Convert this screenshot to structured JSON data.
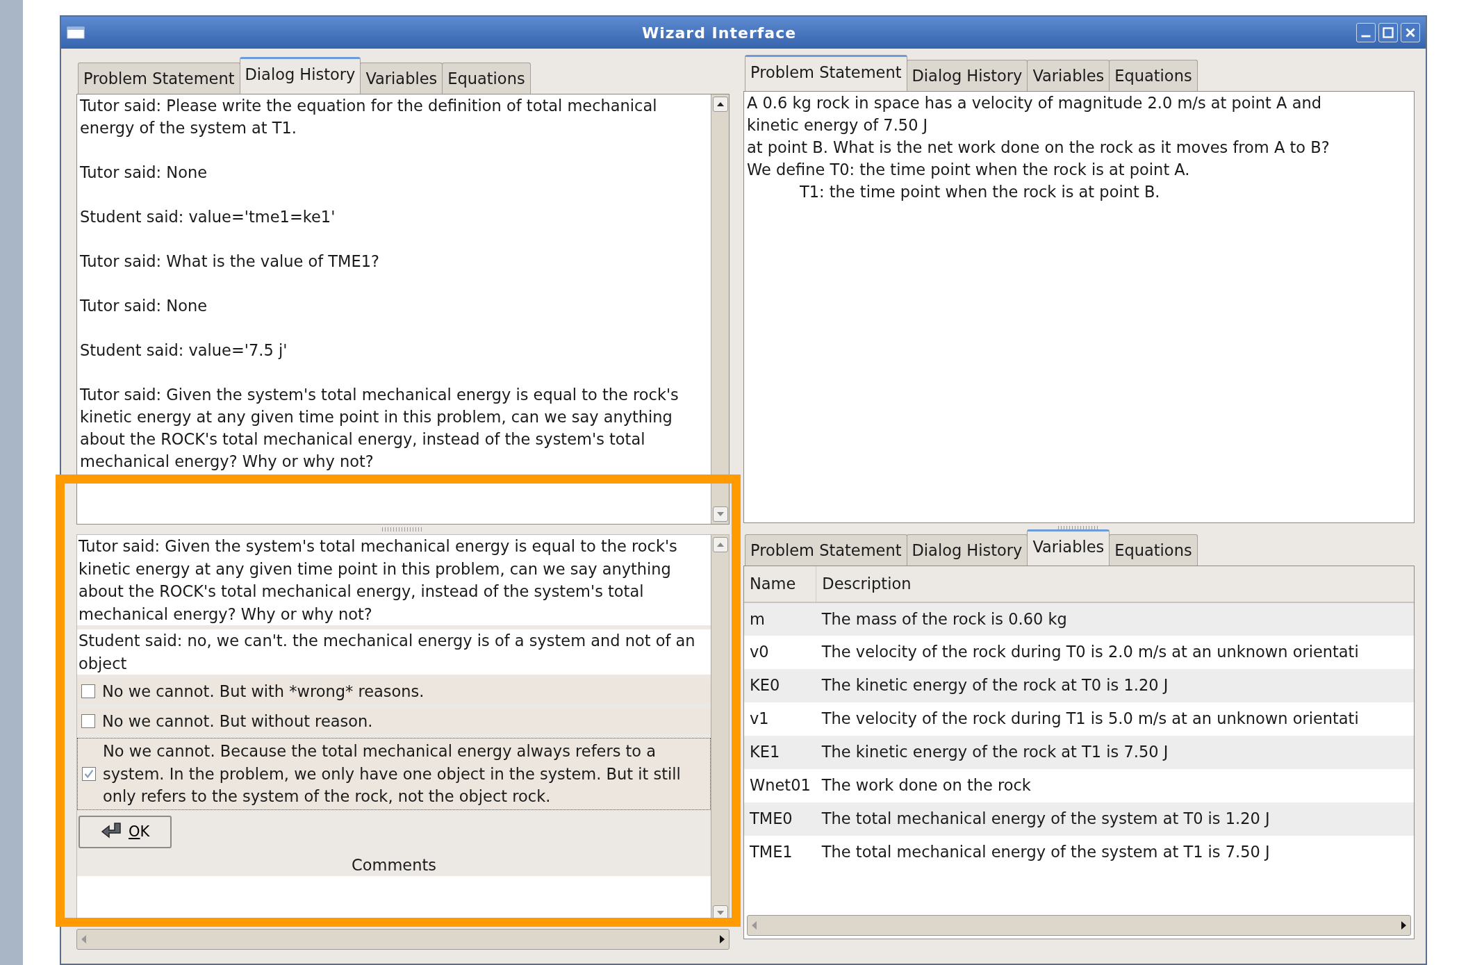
{
  "window": {
    "title": "Wizard Interface"
  },
  "left_panel": {
    "tabs": [
      {
        "label": "Problem Statement",
        "selected": false
      },
      {
        "label": "Dialog History",
        "selected": true
      },
      {
        "label": "Variables",
        "selected": false
      },
      {
        "label": "Equations",
        "selected": false
      }
    ],
    "dialog_history": [
      "Tutor said: Please write the equation for the definition of total mechanical energy of the system at T1.",
      "Tutor said: None",
      "Student said: value='tme1=ke1'",
      "Tutor said: What is the value of TME1?",
      "Tutor said: None",
      "Student said: value='7.5 j'",
      "Tutor said: Given the system's total mechanical energy is equal to the rock's kinetic energy at any given time point in this problem, can we say anything about the ROCK's total mechanical energy, instead of the system's total mechanical energy? Why or why not?"
    ],
    "tutor_message": "Tutor said: Given the system's total mechanical energy is equal to the rock's kinetic energy at any given time point in this problem, can we say anything about the ROCK's total mechanical energy, instead of the system's total mechanical energy? Why or why not?",
    "student_message": "Student said: no, we can't.  the mechanical energy is of a system and not of an object",
    "options": [
      {
        "label": "No we cannot. But with *wrong* reasons.",
        "checked": false,
        "focused": false
      },
      {
        "label": "No we cannot. But without reason.",
        "checked": false,
        "focused": false
      },
      {
        "label": "No we cannot. Because the total mechanical energy always refers to a system. In the problem, we only have one object in the system. But it still only refers to the system of the rock, not the object rock.",
        "checked": true,
        "focused": true
      }
    ],
    "ok_button": "OK",
    "comments_label": "Comments"
  },
  "right_top": {
    "tabs": [
      {
        "label": "Problem Statement",
        "selected": true
      },
      {
        "label": "Dialog History",
        "selected": false
      },
      {
        "label": "Variables",
        "selected": false
      },
      {
        "label": "Equations",
        "selected": false
      }
    ],
    "problem_statement": [
      {
        "text": "A 0.6 kg rock in space has a velocity of magnitude 2.0 m/s at point A and",
        "indented": false
      },
      {
        "text": "kinetic energy of 7.50 J",
        "indented": false
      },
      {
        "text": "at point B. What is the net work done on the rock as it moves from A to B?",
        "indented": false
      },
      {
        "text": "We define T0: the time point when the rock is at point A.",
        "indented": false
      },
      {
        "text": "T1: the time point when the rock is at point B.",
        "indented": true
      }
    ]
  },
  "right_bottom": {
    "tabs": [
      {
        "label": "Problem Statement",
        "selected": false
      },
      {
        "label": "Dialog History",
        "selected": false
      },
      {
        "label": "Variables",
        "selected": true
      },
      {
        "label": "Equations",
        "selected": false
      }
    ],
    "table": {
      "columns": [
        "Name",
        "Description"
      ],
      "rows": [
        [
          "m",
          "The mass of the rock is 0.60 kg"
        ],
        [
          "v0",
          "The velocity of the rock during T0 is 2.0 m/s at an unknown orientati"
        ],
        [
          "KE0",
          "The kinetic energy of the rock at T0 is 1.20 J"
        ],
        [
          "v1",
          "The velocity of the rock during T1 is 5.0 m/s at an unknown orientati"
        ],
        [
          "KE1",
          "The kinetic energy of the rock at T1 is 7.50 J"
        ],
        [
          "Wnet01",
          "The work done on the rock"
        ],
        [
          "TME0",
          "The total mechanical energy of the system at T0 is 1.20 J"
        ],
        [
          "TME1",
          "The total mechanical energy of the system at T1 is 7.50 J"
        ]
      ]
    }
  }
}
